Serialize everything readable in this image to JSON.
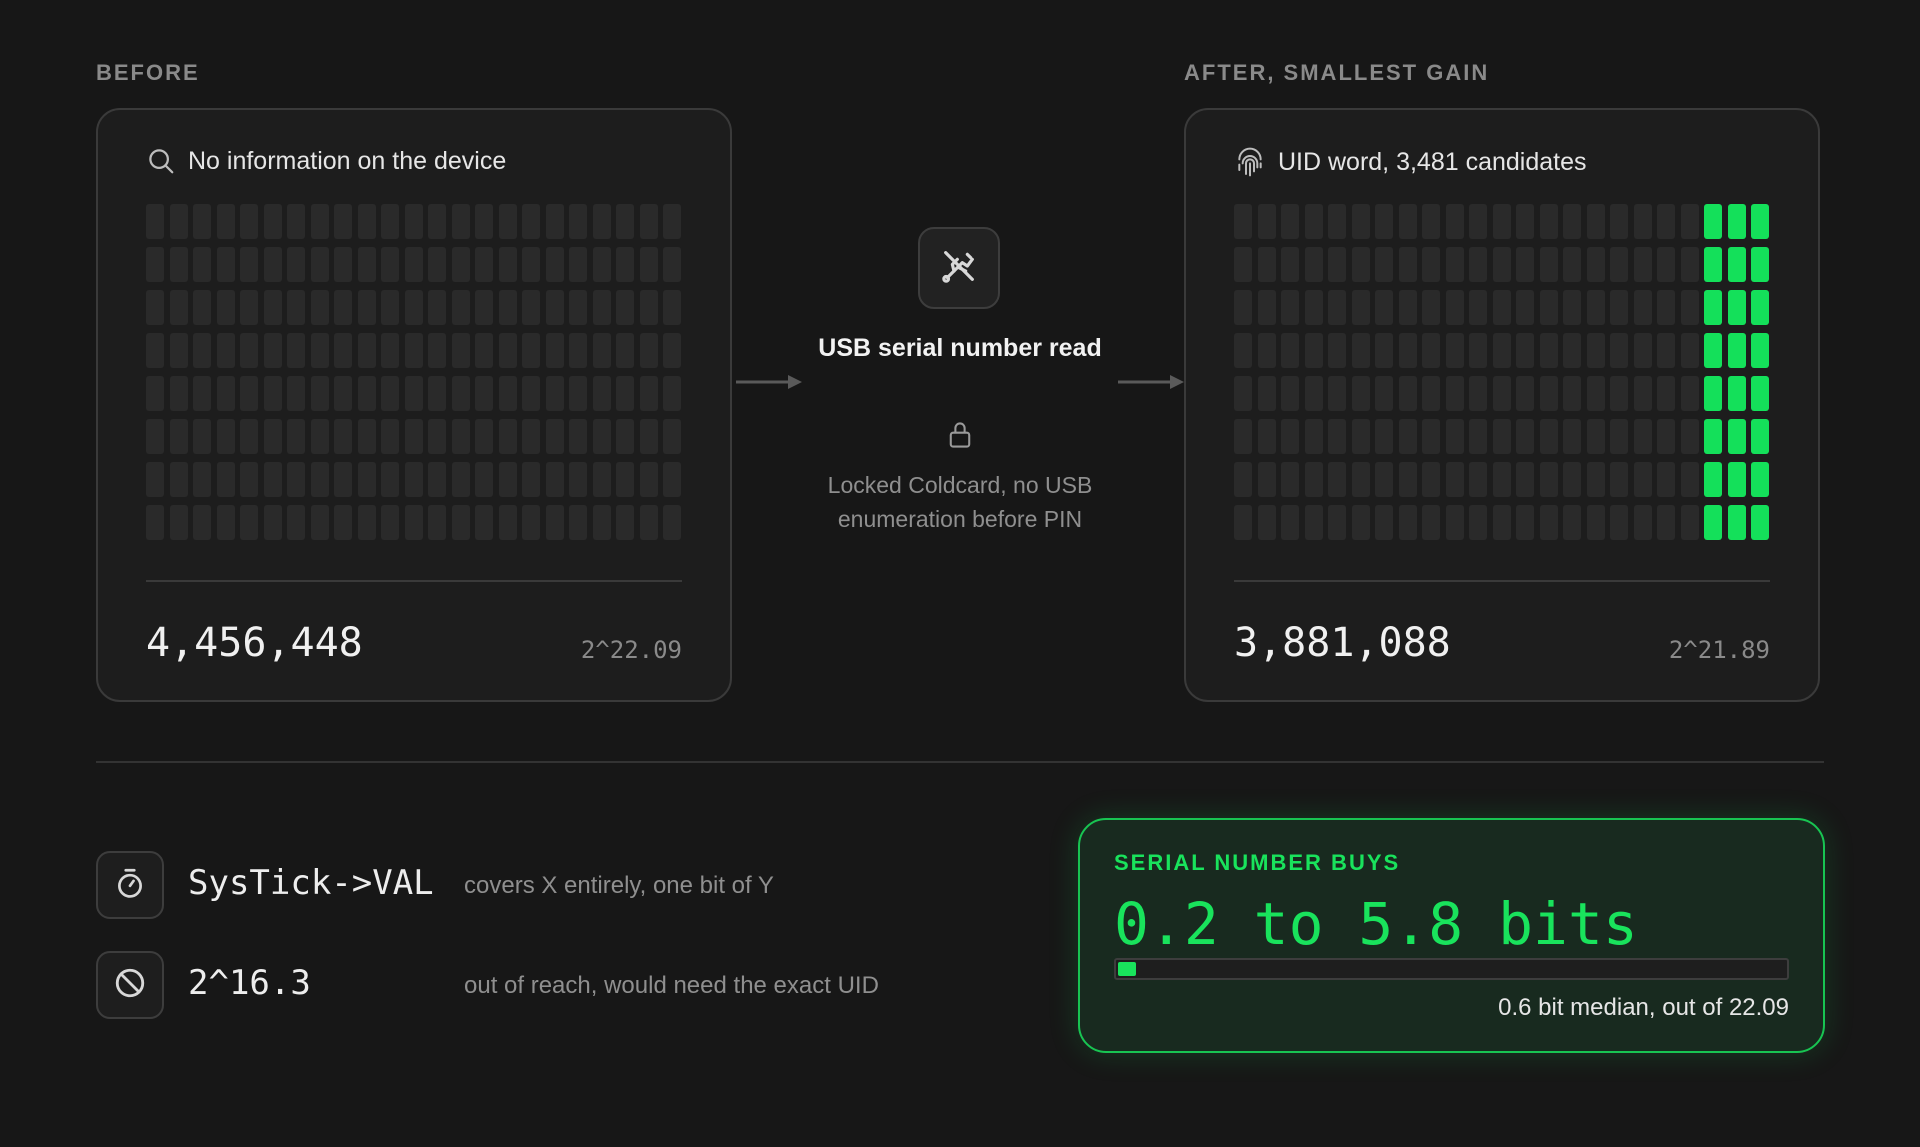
{
  "before": {
    "label": "BEFORE",
    "icon": "search-icon",
    "title": "No information on the device",
    "count": "4,456,448",
    "exponent": "2^22.09",
    "highlighted_columns": 0
  },
  "transition": {
    "icon": "usb-off-icon",
    "title": "USB serial number read",
    "lock_icon": "lock-icon",
    "note_line1": "Locked Coldcard, no USB",
    "note_line2": "enumeration before PIN"
  },
  "after": {
    "label": "AFTER, SMALLEST GAIN",
    "icon": "fingerprint-icon",
    "title": "UID word, 3,481 candidates",
    "count": "3,881,088",
    "exponent": "2^21.89",
    "highlighted_columns": 3
  },
  "facts": [
    {
      "icon": "timer-icon",
      "term": "SysTick->VAL",
      "description": "covers X entirely, one bit of Y"
    },
    {
      "icon": "blocked-icon",
      "term": "2^16.3",
      "description": "out of reach, would need the exact UID"
    }
  ],
  "buys": {
    "label": "SERIAL NUMBER BUYS",
    "range": "0.2 to 5.8 bits",
    "progress_fraction": 0.027,
    "note": "0.6 bit median, out of 22.09"
  },
  "colors": {
    "accent": "#19e35c",
    "background": "#171717",
    "card": "#1d1d1d",
    "cell_off": "#2a2a2a",
    "cell_on": "#14e05a"
  }
}
